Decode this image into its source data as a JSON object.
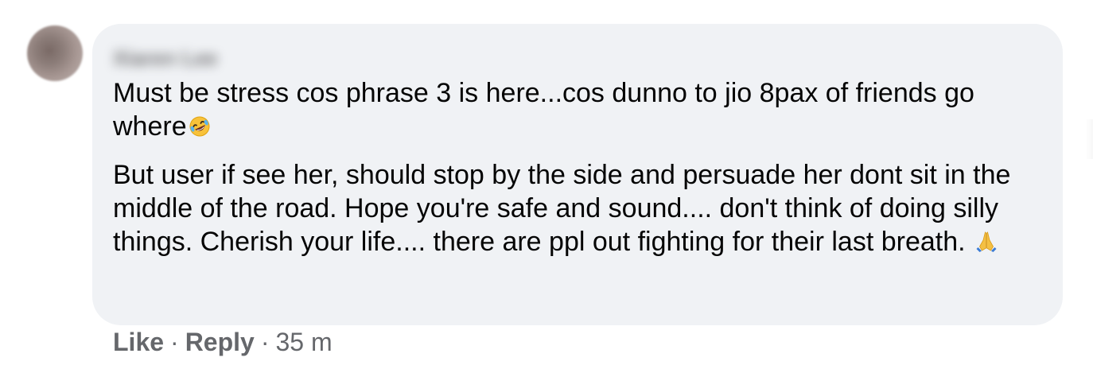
{
  "comment": {
    "author_name": "Xiaren Lee",
    "paragraph1": "Must be stress cos phrase 3 is here...cos dunno to jio 8pax of friends go where",
    "paragraph2": "But user if see her, should stop by the side and persuade her dont sit in the middle of the road. Hope you're safe and sound.... don't think of doing silly things. Cherish your life.... there are ppl out fighting for their last breath.",
    "emoji1": "rolling-on-floor-laughing-emoji",
    "emoji2": "folded-hands-emoji"
  },
  "actions": {
    "like_label": "Like",
    "reply_label": "Reply",
    "separator": "·",
    "timestamp": "35 m"
  },
  "colors": {
    "bubble_bg": "#f0f2f5",
    "text": "#050505",
    "secondary_text": "#65676b"
  }
}
